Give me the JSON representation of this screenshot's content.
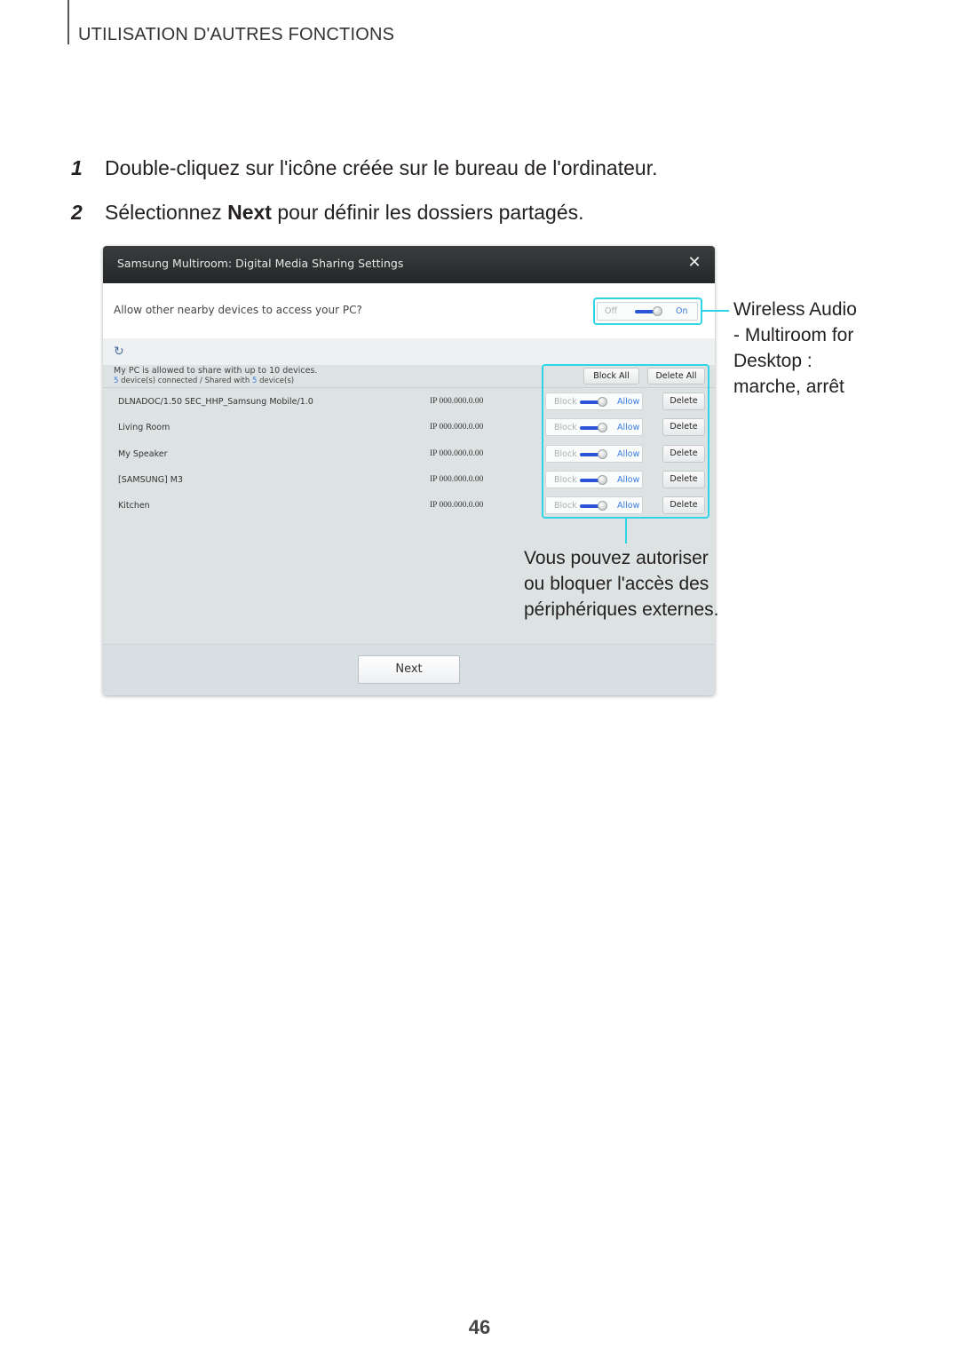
{
  "header": {
    "section_title": "UTILISATION D'AUTRES FONCTIONS"
  },
  "steps": [
    {
      "number": "1",
      "text": "Double-cliquez sur l'icône créée sur le bureau de l'ordinateur."
    },
    {
      "number": "2",
      "text_before": "Sélectionnez ",
      "bold": "Next",
      "text_after": " pour définir les dossiers partagés."
    }
  ],
  "dialog": {
    "title": "Samsung Multiroom: Digital Media Sharing Settings",
    "close_icon": "close-icon",
    "prompt": "Allow other nearby devices to access your PC?",
    "main_toggle": {
      "off_label": "Off",
      "on_label": "On",
      "state": "On"
    },
    "refresh_icon": "refresh-icon",
    "info_line1": "My PC is allowed to share with up to 10 devices.",
    "info_line2": {
      "connected_count": "5",
      "connected_text": " device(s) connected / Shared with ",
      "shared_count": "5",
      "shared_text": " device(s)"
    },
    "block_all_label": "Block All",
    "delete_all_label": "Delete All",
    "devices": [
      {
        "name": "DLNADOC/1.50 SEC_HHP_Samsung Mobile/1.0",
        "ip": "IP 000.000.0.00",
        "block_label": "Block",
        "allow_label": "Allow",
        "state": "Allow",
        "delete_label": "Delete"
      },
      {
        "name": "Living Room",
        "ip": "IP 000.000.0.00",
        "block_label": "Block",
        "allow_label": "Allow",
        "state": "Allow",
        "delete_label": "Delete"
      },
      {
        "name": "My Speaker",
        "ip": "IP 000.000.0.00",
        "block_label": "Block",
        "allow_label": "Allow",
        "state": "Allow",
        "delete_label": "Delete"
      },
      {
        "name": "[SAMSUNG] M3",
        "ip": "IP 000.000.0.00",
        "block_label": "Block",
        "allow_label": "Allow",
        "state": "Allow",
        "delete_label": "Delete"
      },
      {
        "name": "Kitchen",
        "ip": "IP 000.000.0.00",
        "block_label": "Block",
        "allow_label": "Allow",
        "state": "Allow",
        "delete_label": "Delete"
      }
    ],
    "next_label": "Next"
  },
  "callouts": {
    "right_lines": [
      "Wireless Audio",
      "- Multiroom for",
      "Desktop :",
      "marche, arrêt"
    ],
    "bottom_lines": [
      "Vous pouvez autoriser",
      "ou bloquer l'accès des",
      "périphériques externes."
    ],
    "highlight_color": "#2fd5e6"
  },
  "page_number": "46"
}
